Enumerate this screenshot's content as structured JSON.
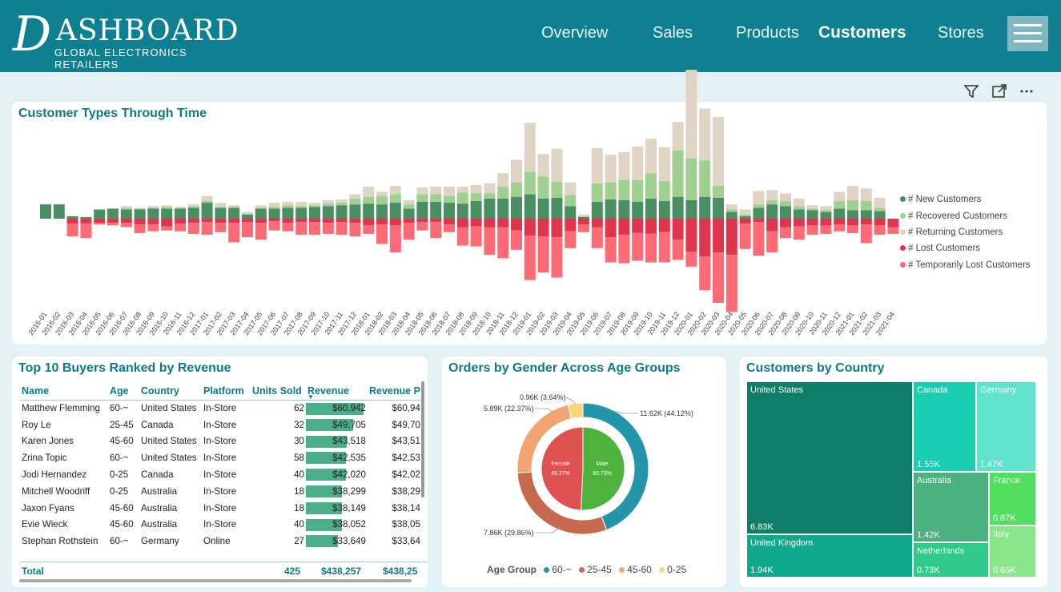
{
  "header": {
    "logo_mark": "D",
    "logo_word": "ASHBOARD",
    "logo_sub": "GLOBAL ELECTRONICS RETAILERS",
    "nav": [
      "Overview",
      "Sales",
      "Products",
      "Customers",
      "Stores"
    ],
    "active_nav": "Customers"
  },
  "colors": {
    "header": "#0e8090",
    "new": "#4a8f63",
    "recovered": "#9fd08f",
    "returning": "#dfd3c3",
    "lost": "#e0354f",
    "temp_lost": "#fe6b75"
  },
  "icons": [
    "filter-icon",
    "focus-mode-icon",
    "more-options-icon",
    "menu-icon"
  ],
  "customer_types": {
    "title": "Customer Types Through Time",
    "legend": [
      "# New Customers",
      "# Recovered Customers",
      "# Returning Customers",
      "# Lost Customers",
      "# Temporarily Lost Customers"
    ]
  },
  "chart_data": [
    {
      "type": "bar",
      "stacked": true,
      "title": "Customer Types Through Time",
      "categories": [
        "2016-01",
        "2016-02",
        "2016-03",
        "2016-04",
        "2016-05",
        "2016-06",
        "2016-07",
        "2016-08",
        "2016-09",
        "2016-10",
        "2016-11",
        "2016-12",
        "2017-01",
        "2017-02",
        "2017-03",
        "2017-04",
        "2017-05",
        "2017-06",
        "2017-07",
        "2017-08",
        "2017-09",
        "2017-10",
        "2017-11",
        "2017-12",
        "2018-01",
        "2018-02",
        "2018-03",
        "2018-04",
        "2018-05",
        "2018-06",
        "2018-07",
        "2018-08",
        "2018-09",
        "2018-10",
        "2018-11",
        "2018-12",
        "2019-01",
        "2019-02",
        "2019-03",
        "2019-04",
        "2019-05",
        "2019-06",
        "2019-07",
        "2019-08",
        "2019-09",
        "2019-10",
        "2019-11",
        "2019-12",
        "2020-01",
        "2020-02",
        "2020-03",
        "2020-04",
        "2020-05",
        "2020-06",
        "2020-07",
        "2020-08",
        "2020-09",
        "2020-10",
        "2020-11",
        "2020-12",
        "2021-01",
        "2021-02",
        "2021-03",
        "2021-04"
      ],
      "series": [
        {
          "name": "# New Customers",
          "values": [
            17,
            17,
            3,
            2,
            11,
            12,
            11,
            11,
            12,
            12,
            12,
            13,
            19,
            13,
            13,
            5,
            12,
            12,
            13,
            13,
            14,
            15,
            16,
            17,
            18,
            17,
            19,
            12,
            20,
            20,
            19,
            18,
            21,
            24,
            24,
            26,
            29,
            24,
            25,
            15,
            2,
            20,
            23,
            22,
            20,
            24,
            21,
            26,
            22,
            26,
            25,
            8,
            3,
            13,
            17,
            15,
            11,
            10,
            8,
            12,
            10,
            10,
            9,
            0
          ]
        },
        {
          "name": "# Recovered Customers",
          "values": [
            0,
            0,
            0,
            0,
            0,
            0,
            2,
            1,
            1,
            2,
            1,
            2,
            2,
            1,
            1,
            1,
            1,
            2,
            3,
            2,
            2,
            3,
            3,
            7,
            8,
            10,
            10,
            5,
            9,
            9,
            8,
            13,
            9,
            6,
            14,
            17,
            27,
            26,
            19,
            13,
            1,
            22,
            20,
            24,
            26,
            30,
            24,
            55,
            50,
            43,
            14,
            3,
            2,
            4,
            5,
            6,
            4,
            2,
            2,
            9,
            12,
            11,
            4,
            0
          ]
        },
        {
          "name": "# Returning Customers",
          "values": [
            0,
            0,
            0,
            0,
            0,
            0,
            2,
            1,
            2,
            2,
            1,
            2,
            6,
            5,
            2,
            2,
            3,
            5,
            4,
            5,
            3,
            4,
            4,
            5,
            12,
            5,
            10,
            5,
            8,
            9,
            11,
            7,
            10,
            12,
            16,
            27,
            58,
            27,
            39,
            15,
            2,
            42,
            33,
            33,
            40,
            41,
            40,
            34,
            105,
            62,
            82,
            6,
            6,
            16,
            12,
            9,
            9,
            4,
            5,
            11,
            17,
            15,
            12,
            0
          ]
        },
        {
          "name": "# Lost Customers",
          "values": [
            0,
            0,
            -6,
            -6,
            -5,
            -5,
            -5,
            -7,
            -7,
            -9,
            -6,
            -5,
            -4,
            -5,
            -5,
            -4,
            -5,
            -3,
            -5,
            -4,
            -4,
            -5,
            -4,
            -5,
            -8,
            -7,
            -8,
            -5,
            -4,
            -4,
            -7,
            -10,
            -9,
            -10,
            -10,
            -14,
            -20,
            -21,
            -22,
            -15,
            -7,
            -10,
            -22,
            -19,
            -17,
            -18,
            -16,
            -25,
            -39,
            -45,
            -40,
            -43,
            -6,
            -4,
            -15,
            -10,
            -9,
            -8,
            -8,
            -7,
            -8,
            -7,
            -8,
            -10
          ]
        },
        {
          "name": "# Temporarily Lost Customers",
          "values": [
            0,
            0,
            -15,
            -17,
            -2,
            -3,
            -5,
            -10,
            -8,
            -5,
            -9,
            -13,
            -15,
            -11,
            -23,
            -18,
            -20,
            -11,
            -10,
            -15,
            -15,
            -13,
            -15,
            -16,
            -10,
            -23,
            -32,
            -20,
            -10,
            -19,
            -9,
            -22,
            -24,
            -33,
            -37,
            -23,
            -53,
            -43,
            -48,
            -20,
            -9,
            -25,
            -30,
            -34,
            -33,
            -34,
            -36,
            -24,
            -18,
            -40,
            -60,
            -68,
            -30,
            -40,
            -25,
            -13,
            -16,
            -11,
            -10,
            -8,
            -9,
            -22,
            -11,
            -8
          ]
        }
      ]
    },
    {
      "type": "table",
      "title": "Top 10 Buyers Ranked by Revenue",
      "columns": [
        "Name",
        "Age",
        "Country",
        "Platform",
        "Units Sold",
        "Revenue",
        "Revenue P"
      ],
      "rows": [
        [
          "Matthew Flemming",
          "60-~",
          "United States",
          "In-Store",
          "62",
          "$60,942",
          "$60,94"
        ],
        [
          "Roy Le",
          "25-45",
          "Canada",
          "In-Store",
          "32",
          "$49,705",
          "$49,70"
        ],
        [
          "Karen Jones",
          "45-60",
          "United States",
          "In-Store",
          "30",
          "$43,518",
          "$43,51"
        ],
        [
          "Zrina Topic",
          "60-~",
          "United States",
          "In-Store",
          "58",
          "$42,535",
          "$42,53"
        ],
        [
          "Jodi Hernandez",
          "0-25",
          "Canada",
          "In-Store",
          "40",
          "$42,020",
          "$42,02"
        ],
        [
          "Mitchell Woodriff",
          "0-25",
          "Australia",
          "In-Store",
          "18",
          "$38,299",
          "$38,29"
        ],
        [
          "Jaxon Fyans",
          "45-60",
          "Australia",
          "In-Store",
          "18",
          "$38,149",
          "$38,14"
        ],
        [
          "Evie Wieck",
          "45-60",
          "Australia",
          "In-Store",
          "40",
          "$38,052",
          "$38,05"
        ],
        [
          "Stephan Rothstein",
          "60-~",
          "Germany",
          "Online",
          "27",
          "$33,649",
          "$33,64"
        ]
      ],
      "revenue_values": [
        60942,
        49705,
        43518,
        42535,
        42020,
        38299,
        38149,
        38052,
        33649
      ],
      "total": {
        "label": "Total",
        "units": "425",
        "revenue": "$438,257",
        "revenue_p": "$438,25"
      }
    },
    {
      "type": "pie",
      "title": "Orders by Gender Across Age Groups",
      "outer": [
        {
          "name": "60-~",
          "value": 11.62,
          "label": "11.62K (44.12%)"
        },
        {
          "name": "25-45",
          "value": 7.86,
          "label": "7.86K (29.86%)"
        },
        {
          "name": "45-60",
          "value": 5.89,
          "label": "5.89K (22.37%)"
        },
        {
          "name": "0-25",
          "value": 0.96,
          "label": "0.96K (3.64%)"
        }
      ],
      "inner": [
        {
          "name": "Male",
          "share": 50.73,
          "label": "50.73%"
        },
        {
          "name": "Female",
          "share": 49.27,
          "label": "49.27%"
        }
      ],
      "legend_title": "Age Group",
      "legend": [
        "60-~",
        "25-45",
        "45-60",
        "0-25"
      ]
    },
    {
      "type": "treemap",
      "title": "Customers by Country",
      "items": [
        {
          "name": "United States",
          "value": "6.83K"
        },
        {
          "name": "United Kingdom",
          "value": "1.94K"
        },
        {
          "name": "Canada",
          "value": "1.55K"
        },
        {
          "name": "Germany",
          "value": "1.47K"
        },
        {
          "name": "Australia",
          "value": "1.42K"
        },
        {
          "name": "Netherlands",
          "value": "0.73K"
        },
        {
          "name": "France",
          "value": "0.67K"
        },
        {
          "name": "Italy",
          "value": "0.65K"
        }
      ]
    }
  ]
}
